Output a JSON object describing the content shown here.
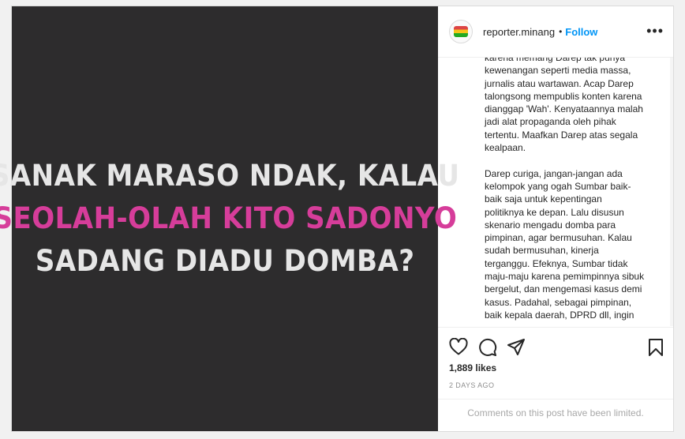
{
  "header": {
    "username": "reporter.minang",
    "separator": "•",
    "follow_label": "Follow",
    "more_label": "•••"
  },
  "media": {
    "line1": "SANAK MARASO NDAK, KALAU",
    "line2": "SEOLAH-OLAH KITO SADONYO",
    "line3": "SADANG DIADU DOMBA?",
    "accent_color": "#d63d9a",
    "background_color": "#2d2c2d"
  },
  "caption": {
    "text": "karena memang Darep tak punya\nkewenangan seperti media massa,\njurnalis atau wartawan. Acap Darep\ntalongsong mempublis konten karena\ndianggap 'Wah'. Kenyataannya malah\njadi alat propaganda oleh pihak\ntertentu. Maafkan Darep atas segala\nkealpaan.\n\nDarep curiga, jangan-jangan ada\nkelompok yang ogah Sumbar baik-\nbaik saja untuk kepentingan\npolitiknya ke depan. Lalu disusun\nskenario mengadu domba para\npimpinan, agar bermusuhan. Kalau\nsudah bermusuhan, kinerja\nterganggu. Efeknya, Sumbar tidak\nmaju-maju karena pemimpinnya sibuk\nbergelut, dan mengemasi kasus demi\nkasus. Padahal, sebagai pimpinan,\nbaik kepala daerah, DPRD dll, ingin"
  },
  "actions": {
    "like_icon": "heart-icon",
    "comment_icon": "comment-icon",
    "share_icon": "share-icon",
    "save_icon": "bookmark-icon"
  },
  "stats": {
    "likes": "1,889 likes",
    "date": "2 DAYS AGO"
  },
  "footer": {
    "comments_limited": "Comments on this post have been limited."
  }
}
